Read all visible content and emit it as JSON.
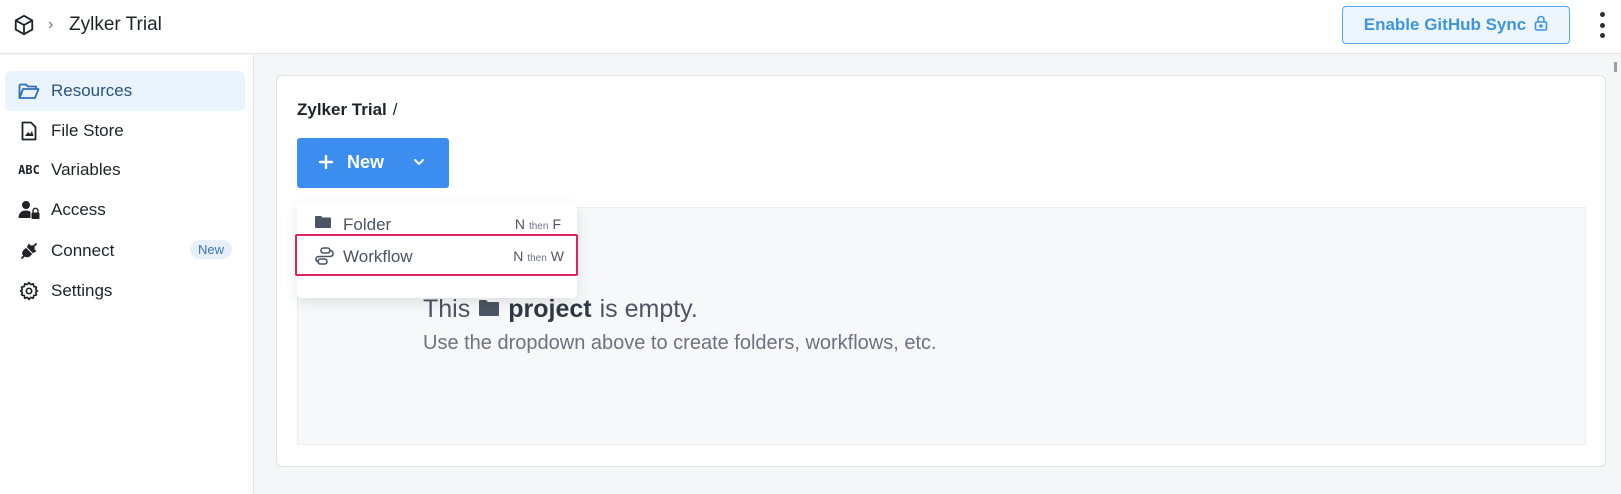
{
  "header": {
    "project_title": "Zylker Trial",
    "breadcrumb_sep": "›",
    "github_sync_label": "Enable GitHub Sync"
  },
  "sidebar": {
    "items": [
      {
        "label": "Resources",
        "icon": "folder-open-icon",
        "active": true
      },
      {
        "label": "File Store",
        "icon": "file-icon"
      },
      {
        "label": "Variables",
        "icon": "abc-icon",
        "icon_text": "ABC"
      },
      {
        "label": "Access",
        "icon": "user-lock-icon"
      },
      {
        "label": "Connect",
        "icon": "plug-icon",
        "badge": "New"
      },
      {
        "label": "Settings",
        "icon": "gear-icon"
      }
    ]
  },
  "main": {
    "path_title": "Zylker Trial",
    "path_sep": "/",
    "new_button_label": "New",
    "empty_state": {
      "prefix": "This",
      "emphasis": "project",
      "suffix": "is empty.",
      "hint": "Use the dropdown above to create folders, workflows, etc."
    }
  },
  "dropdown": {
    "items": [
      {
        "label": "Folder",
        "key1": "N",
        "then": "then",
        "key2": "F"
      },
      {
        "label": "Workflow",
        "key1": "N",
        "then": "then",
        "key2": "W",
        "highlighted": true
      }
    ]
  },
  "colors": {
    "accent": "#3b8ef0",
    "highlight_border": "#e0245e",
    "sync_text": "#3d95e3"
  }
}
